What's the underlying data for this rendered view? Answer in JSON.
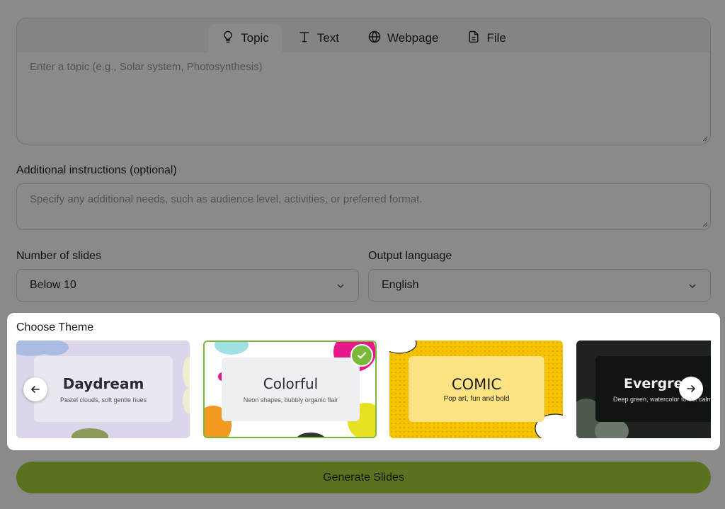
{
  "tabs": [
    {
      "label": "Topic",
      "icon": "lightbulb-icon",
      "active": true
    },
    {
      "label": "Text",
      "icon": "text-icon",
      "active": false
    },
    {
      "label": "Webpage",
      "icon": "globe-icon",
      "active": false
    },
    {
      "label": "File",
      "icon": "file-icon",
      "active": false
    }
  ],
  "topic": {
    "placeholder": "Enter a topic (e.g., Solar system, Photosynthesis)"
  },
  "instructions": {
    "label": "Additional instructions (optional)",
    "placeholder": "Specify any additional needs, such as audience level, activities, or preferred format."
  },
  "slides": {
    "label": "Number of slides",
    "value": "Below 10"
  },
  "language": {
    "label": "Output language",
    "value": "English"
  },
  "theme": {
    "title": "Choose Theme",
    "cards": [
      {
        "name": "Daydream",
        "desc": "Pastel clouds, soft gentle hues",
        "selected": false
      },
      {
        "name": "Colorful",
        "desc": "Neon shapes, bubbly organic flair",
        "selected": true
      },
      {
        "name": "COMIC",
        "desc": "Pop art, fun and bold",
        "selected": false
      },
      {
        "name": "Evergreen",
        "desc": "Deep green, watercolor forest calm",
        "selected": false
      }
    ]
  },
  "generate_label": "Generate Slides",
  "colors": {
    "accent": "#a7d23c",
    "selected_border": "#7ab83a"
  }
}
